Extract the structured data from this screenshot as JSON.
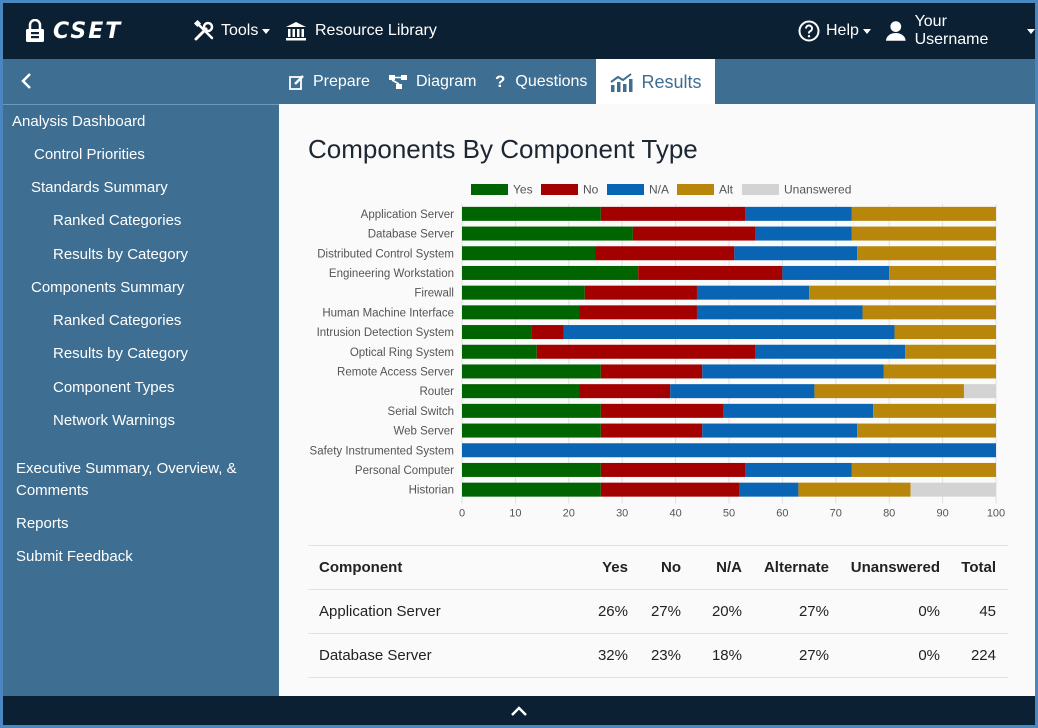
{
  "nav": {
    "logo": "CSET",
    "tools": "Tools",
    "resource_library": "Resource Library",
    "help": "Help",
    "user": "Your Username"
  },
  "tabs": [
    {
      "label": "Prepare",
      "icon": "pencil-square-icon"
    },
    {
      "label": "Diagram",
      "icon": "diagram-nodes-icon"
    },
    {
      "label": "Questions",
      "icon": "question-mark-icon"
    },
    {
      "label": "Results",
      "icon": "bar-chart-icon",
      "active": true
    }
  ],
  "sidebar": {
    "items": [
      {
        "label": "Analysis Dashboard",
        "level": 0
      },
      {
        "label": "Control Priorities",
        "level": 1
      },
      {
        "label": "Standards Summary",
        "level": 1
      },
      {
        "label": "Ranked Categories",
        "level": 2
      },
      {
        "label": "Results by Category",
        "level": 2
      },
      {
        "label": "Components Summary",
        "level": 1
      },
      {
        "label": "Ranked Categories",
        "level": 2
      },
      {
        "label": "Results by Category",
        "level": 2
      },
      {
        "label": "Component Types",
        "level": 2
      },
      {
        "label": "Network Warnings",
        "level": 2
      },
      {
        "label": "Executive Summary, Overview, &",
        "label2": "Comments",
        "level": 0
      },
      {
        "label": "Reports",
        "level": 0
      },
      {
        "label": "Submit Feedback",
        "level": 0
      }
    ]
  },
  "page_title": "Components By Component Type",
  "colors": {
    "yes": "#006400",
    "no": "#a30000",
    "na": "#0a64b4",
    "alt": "#b8860b",
    "unanswered": "#d3d3d3",
    "nav_dark": "#0b2033",
    "nav_blue": "#3e6e91"
  },
  "chart_data": {
    "type": "bar",
    "orientation": "horizontal",
    "stacked": true,
    "categories": [
      "Application Server",
      "Database Server",
      "Distributed Control System",
      "Engineering Workstation",
      "Firewall",
      "Human Machine Interface",
      "Intrusion Detection System",
      "Optical Ring System",
      "Remote Access Server",
      "Router",
      "Serial Switch",
      "Web Server",
      "Safety Instrumented System",
      "Personal Computer",
      "Historian"
    ],
    "series": [
      {
        "name": "Yes",
        "values": [
          26,
          32,
          25,
          33,
          23,
          22,
          13,
          14,
          26,
          22,
          26,
          26,
          0,
          26,
          26
        ]
      },
      {
        "name": "No",
        "values": [
          27,
          23,
          26,
          27,
          21,
          22,
          6,
          41,
          19,
          17,
          23,
          19,
          0,
          27,
          26
        ]
      },
      {
        "name": "N/A",
        "values": [
          20,
          18,
          23,
          20,
          21,
          31,
          62,
          28,
          34,
          27,
          28,
          29,
          100,
          20,
          11
        ]
      },
      {
        "name": "Alt",
        "values": [
          27,
          27,
          26,
          20,
          35,
          25,
          19,
          17,
          21,
          28,
          23,
          26,
          0,
          27,
          21
        ]
      },
      {
        "name": "Unanswered",
        "values": [
          0,
          0,
          0,
          0,
          0,
          0,
          0,
          0,
          0,
          6,
          0,
          0,
          0,
          0,
          16
        ]
      }
    ],
    "xlim": [
      0,
      100
    ],
    "xticks": [
      0,
      10,
      20,
      30,
      40,
      50,
      60,
      70,
      80,
      90,
      100
    ],
    "grid": true,
    "legend": "top"
  },
  "table": {
    "headers": [
      "Component",
      "Yes",
      "No",
      "N/A",
      "Alternate",
      "Unanswered",
      "Total"
    ],
    "rows": [
      [
        "Application Server",
        "26%",
        "27%",
        "20%",
        "27%",
        "0%",
        "45"
      ],
      [
        "Database Server",
        "32%",
        "23%",
        "18%",
        "27%",
        "0%",
        "224"
      ]
    ]
  }
}
